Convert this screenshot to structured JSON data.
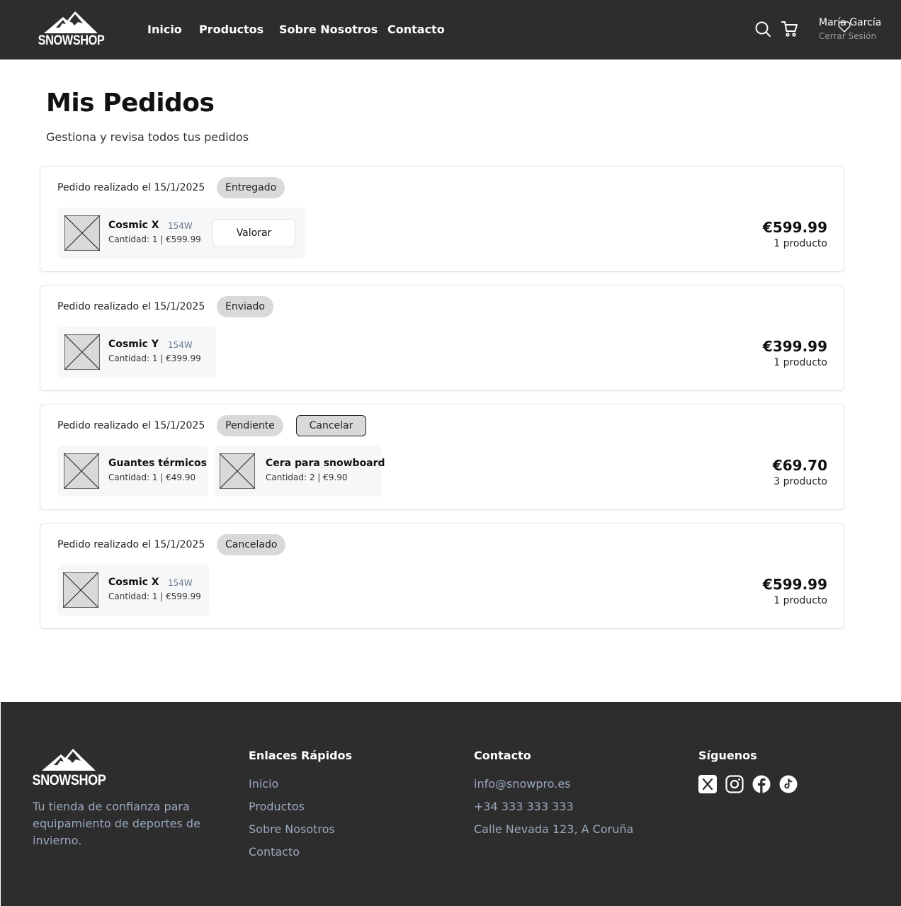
{
  "brand": {
    "name": "SNOWSHOP"
  },
  "nav": {
    "items": [
      "Inicio",
      "Productos",
      "Sobre Nosotros",
      "Contacto"
    ]
  },
  "header_icons": [
    "search-icon",
    "cart-icon",
    "heart-icon"
  ],
  "user": {
    "name": "María García",
    "logout": "Cerrar Sesión"
  },
  "page": {
    "title": "Mis Pedidos",
    "subtitle": "Gestiona y revisa todos tus pedidos"
  },
  "orders": [
    {
      "date_label": "Pedido realizado el 15/1/2025",
      "status": "Entregado",
      "action": "Valorar",
      "items": [
        {
          "name": "Cosmic X",
          "size": "154W",
          "qty": "Cantidad: 1 | €599.99"
        }
      ],
      "total": "€599.99",
      "count": "1 producto"
    },
    {
      "date_label": "Pedido realizado el 15/1/2025",
      "status": "Enviado",
      "items": [
        {
          "name": "Cosmic Y",
          "size": "154W",
          "qty": "Cantidad: 1 | €399.99"
        }
      ],
      "total": "€399.99",
      "count": "1 producto"
    },
    {
      "date_label": "Pedido realizado el 15/1/2025",
      "status": "Pendiente",
      "cancel": "Cancelar",
      "items": [
        {
          "name": "Guantes térmicos",
          "qty": "Cantidad: 1 | €49.90"
        },
        {
          "name": "Cera para snowboard",
          "qty": "Cantidad: 2 | €9.90"
        }
      ],
      "total": "€69.70",
      "count": "3 producto"
    },
    {
      "date_label": "Pedido realizado el 15/1/2025",
      "status": "Cancelado",
      "items": [
        {
          "name": "Cosmic X",
          "size": "154W",
          "qty": "Cantidad: 1 | €599.99"
        }
      ],
      "total": "€599.99",
      "count": "1 producto"
    }
  ],
  "footer": {
    "tagline": "Tu tienda de confianza para equipamiento de deportes de invierno.",
    "links_title": "Enlaces Rápidos",
    "links": [
      "Inicio",
      "Productos",
      "Sobre Nosotros",
      "Contacto"
    ],
    "contact_title": "Contacto",
    "contact": [
      "info@snowpro.es",
      "+34 333 333 333",
      "Calle Nevada 123, A Coruña"
    ],
    "social_title": "Síguenos",
    "social_icons": [
      "x-icon",
      "instagram-icon",
      "facebook-icon",
      "tiktok-icon"
    ]
  },
  "colors": {
    "header_bg": "#2d2d2d",
    "badge_bg": "#d9d9d9",
    "item_bg": "#f6f7f9",
    "footer_text": "#9aa8bb"
  }
}
